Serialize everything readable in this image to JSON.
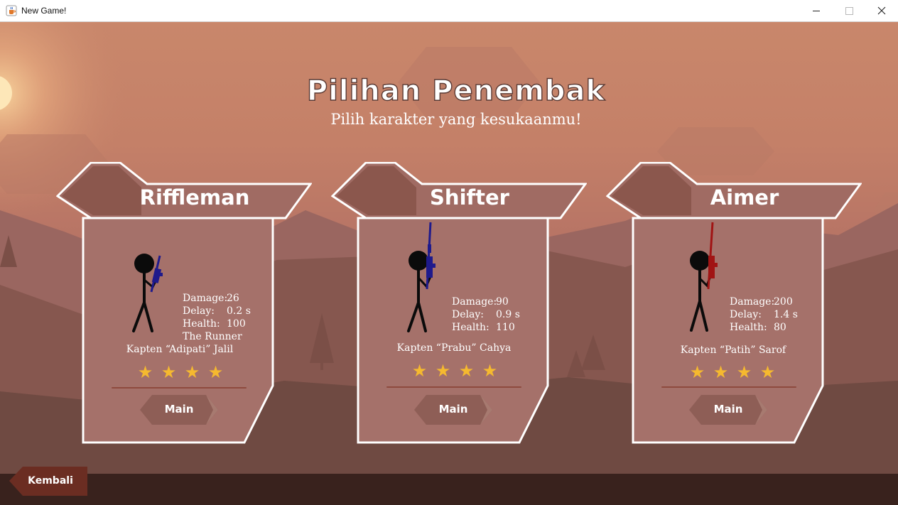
{
  "window": {
    "title": "New Game!",
    "icon": "java-cup-icon",
    "controls": [
      "minimize-icon",
      "maximize-icon",
      "close-icon"
    ]
  },
  "header": {
    "title": "Pilihan Penembak",
    "subtitle": "Pilih karakter yang kesukaanmu!"
  },
  "characters": [
    {
      "name": "Riffleman",
      "weapon_color": "#1f1a8c",
      "stats": [
        {
          "label": "Damage:",
          "value": "26"
        },
        {
          "label": "Delay:",
          "value": "0.2 s"
        },
        {
          "label": "Health:",
          "value": "100"
        }
      ],
      "trait": "The Runner",
      "captain": "Kapten “Adipati” Jalil",
      "stars": 4,
      "button": "Main"
    },
    {
      "name": "Shifter",
      "weapon_color": "#1f1a8c",
      "stats": [
        {
          "label": "Damage:",
          "value": "90"
        },
        {
          "label": "Delay:",
          "value": "0.9 s"
        },
        {
          "label": "Health:",
          "value": "110"
        }
      ],
      "captain": "Kapten “Prabu” Cahya",
      "stars": 4,
      "button": "Main"
    },
    {
      "name": "Aimer",
      "weapon_color": "#a11414",
      "stats": [
        {
          "label": "Damage:",
          "value": "200"
        },
        {
          "label": "Delay:",
          "value": "1.4 s"
        },
        {
          "label": "Health:",
          "value": "80"
        }
      ],
      "captain": "Kapten “Patih” Sarof",
      "stars": 4,
      "button": "Main"
    }
  ],
  "footer": {
    "back_label": "Kembali"
  },
  "colors": {
    "card_fill": "#a5716a",
    "card_header_fill": "#a06b63",
    "card_tab_fill": "#8b574d",
    "card_border": "#ffffff",
    "star": "#f5b92f",
    "button_fill": "#8e5e56",
    "back_button_fill": "#6b2d22",
    "footer_bar": "#39221d"
  }
}
